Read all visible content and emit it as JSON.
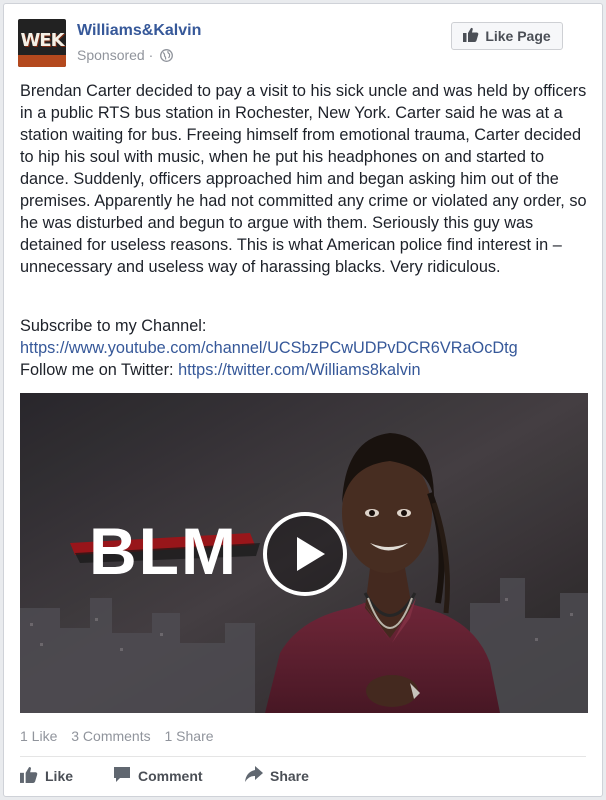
{
  "header": {
    "page_name": "Williams&Kalvin",
    "avatar_text": "WEK",
    "sponsored": "Sponsored",
    "separator": "·",
    "like_page_label": "Like Page"
  },
  "post": {
    "body": "Brendan Carter decided to pay a visit to his sick uncle and was held by officers in a public RTS bus station in Rochester, New York. Carter said he was at a station waiting for bus. Freeing himself from emotional trauma, Carter decided to hip his soul with music, when he put his headphones on and started to dance. Suddenly, officers approached him and began asking him out of the premises. Apparently he had not committed any crime or violated any order, so he was disturbed and begun to argue with them. Seriously this guy was detained for useless reasons. This is what American police find interest in – unnecessary and useless way of harassing blacks. Very ridiculous.",
    "subscribe_label": "Subscribe to my Channel:",
    "youtube_link": "https://www.youtube.com/channel/UCSbzPCwUDPvDCR6VRaOcDtg",
    "twitter_label": "Follow me on Twitter:",
    "twitter_link": "https://twitter.com/Williams8kalvin"
  },
  "video": {
    "overlay_text": "BLM"
  },
  "stats": {
    "likes": "1 Like",
    "comments": "3 Comments",
    "shares": "1 Share"
  },
  "actions": {
    "like": "Like",
    "comment": "Comment",
    "share": "Share"
  },
  "colors": {
    "link": "#365899",
    "muted": "#90949c",
    "text": "#1d2129"
  }
}
